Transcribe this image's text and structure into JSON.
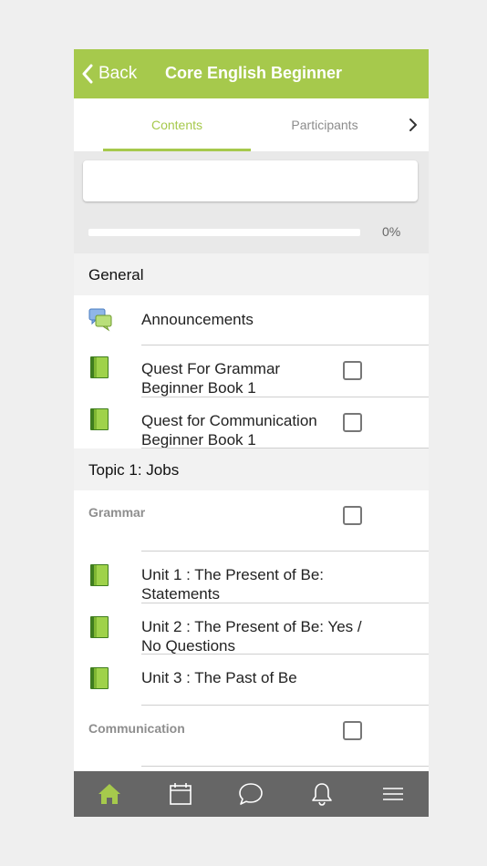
{
  "header": {
    "back_label": "Back",
    "title": "Core English Beginner"
  },
  "tabs": [
    {
      "label": "Contents",
      "active": true
    },
    {
      "label": "Participants",
      "active": false
    }
  ],
  "progress": {
    "text": "0%",
    "value": 0
  },
  "sections": [
    {
      "title": "General",
      "items": [
        {
          "label": "Announcements",
          "icon": "forum-icon",
          "checkbox": false
        },
        {
          "label": "Quest For Grammar Beginner Book 1",
          "line1": "Quest For Grammar",
          "line2": "Beginner Book 1",
          "icon": "book-icon",
          "checkbox": true,
          "checked": false
        },
        {
          "label": "Quest for Communication Beginner Book 1",
          "line1": "Quest for Communication",
          "line2": "Beginner Book 1",
          "icon": "book-icon",
          "checkbox": true,
          "checked": false
        }
      ]
    },
    {
      "title": "Topic 1: Jobs",
      "items": [
        {
          "label": "Grammar",
          "type": "label",
          "checkbox": true,
          "checked": false
        },
        {
          "label": "Unit 1 : The Present of Be: Statements",
          "line1": "Unit 1 : The Present of Be:",
          "line2": "Statements",
          "icon": "book-icon"
        },
        {
          "label": "Unit 2 : The Present of Be: Yes / No Questions",
          "line1": "Unit 2 : The Present of Be: Yes /",
          "line2": "No Questions",
          "icon": "book-icon"
        },
        {
          "label": "Unit 3 : The Past of Be",
          "line1": "Unit 3 : The Past of Be",
          "icon": "book-icon"
        },
        {
          "label": "Communication",
          "type": "label",
          "checkbox": true,
          "checked": false
        }
      ]
    }
  ],
  "bottom_nav": [
    {
      "icon": "home-icon",
      "active": true
    },
    {
      "icon": "calendar-icon",
      "active": false
    },
    {
      "icon": "chat-icon",
      "active": false
    },
    {
      "icon": "bell-icon",
      "active": false
    },
    {
      "icon": "menu-icon",
      "active": false
    }
  ],
  "colors": {
    "accent": "#a6c94c",
    "nav_bg": "#666666",
    "section_bg": "#f2f2f2"
  }
}
